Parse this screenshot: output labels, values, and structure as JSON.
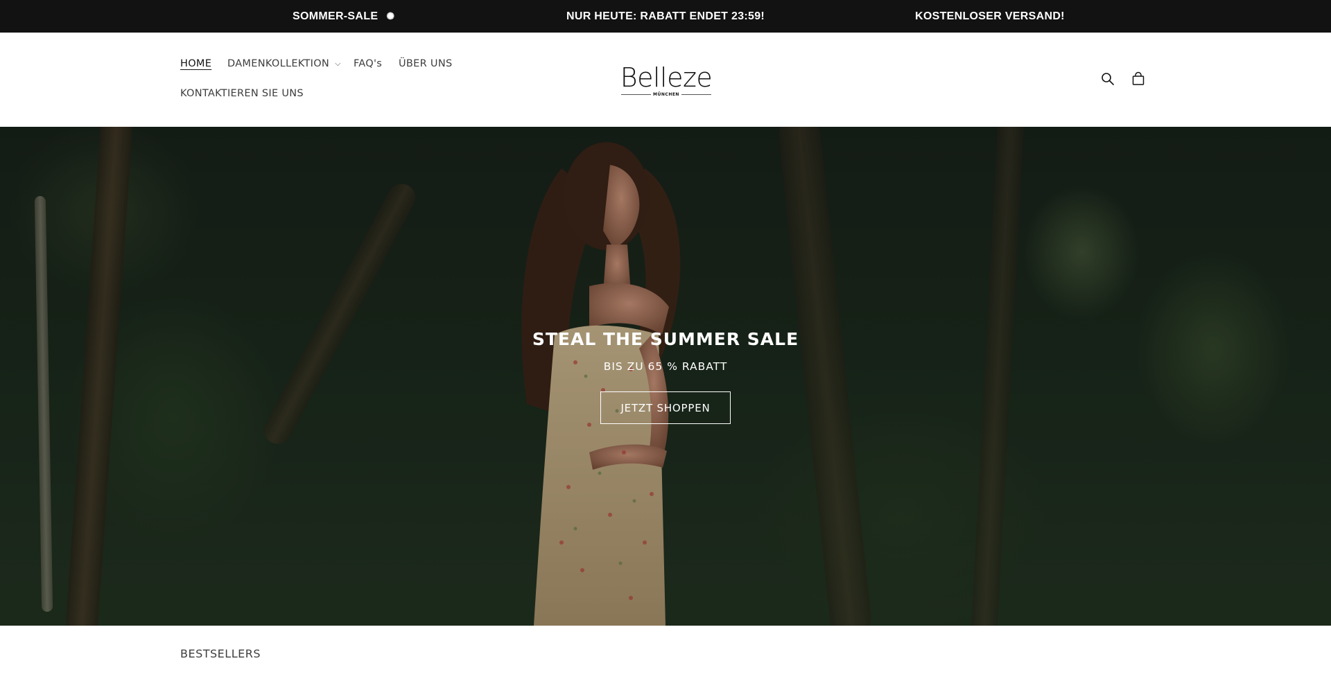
{
  "announcement": {
    "messages": [
      "SOMMER-SALE",
      "NUR HEUTE: RABATT ENDET 23:59!",
      "KOSTENLOSER VERSAND!"
    ],
    "sale_icon": "sun-icon",
    "background": "#121212"
  },
  "nav": {
    "home": "HOME",
    "damenkollektion": "DAMENKOLLEKTION",
    "faq": "FAQ's",
    "ueber_uns": "ÜBER UNS",
    "kontakt": "KONTAKTIEREN SIE UNS",
    "active": "HOME"
  },
  "logo": {
    "brand": "Belleze",
    "city": "MÜNCHEN"
  },
  "header_icons": [
    "search-icon",
    "cart-icon"
  ],
  "hero": {
    "title": "STEAL THE SUMMER SALE",
    "subtitle": "BIS ZU 65 % RABATT",
    "button": "JETZT SHOPPEN"
  },
  "sections": {
    "bestsellers": "BESTSELLERS"
  }
}
